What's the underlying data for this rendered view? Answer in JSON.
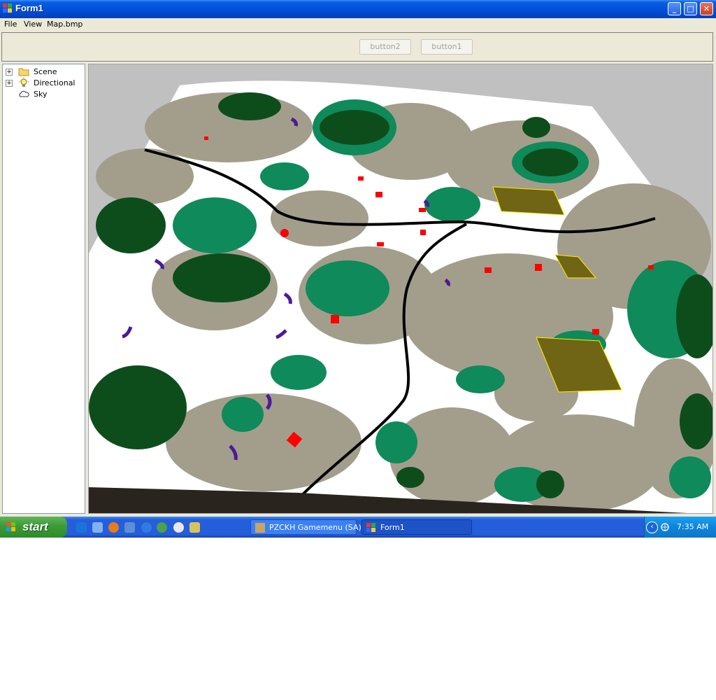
{
  "window": {
    "title": "Form1",
    "controls": {
      "minimize": "_",
      "maximize": "□",
      "close": "✕"
    }
  },
  "menu": [
    "File",
    "View",
    "Map.bmp"
  ],
  "toolbar": {
    "button2_label": "button2",
    "button1_label": "button1"
  },
  "tree": {
    "items": [
      {
        "label": "Scene",
        "icon": "folder-icon",
        "expander": "+"
      },
      {
        "label": "Directional",
        "icon": "lightbulb-icon",
        "expander": "+"
      },
      {
        "label": "Sky",
        "icon": "cloud-icon",
        "expander": ""
      }
    ]
  },
  "taskbar": {
    "start_label": "start",
    "quick_launch": [
      "internet-explorer-icon",
      "show-desktop-icon",
      "firefox-icon",
      "outlook-icon",
      "search-icon",
      "chrome-icon",
      "media-player-icon",
      "monitor-icon"
    ],
    "tasks": [
      {
        "label": "PZCKH Gamemenu (SA)",
        "icon": "game-icon",
        "active": false
      },
      {
        "label": "Form1",
        "icon": "form-icon",
        "active": true
      }
    ],
    "clock": "7:35 AM"
  },
  "colors": {
    "terrain_snow": "#ffffff",
    "terrain_rock": "#a39e8b",
    "terrain_forest_light": "#0f8a5a",
    "terrain_forest_dark": "#0d4d1c",
    "road": "#000000",
    "objective": "#6f6515",
    "marker_red": "#ff0000",
    "marker_purple": "#4b1b95"
  }
}
